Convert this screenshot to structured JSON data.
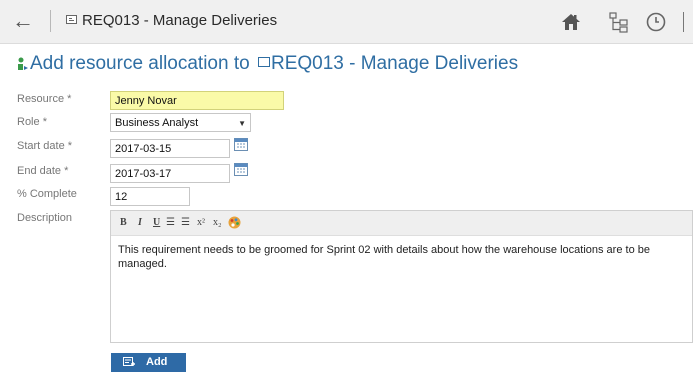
{
  "topbar": {
    "back_glyph": "←",
    "title": "REQ013 - Manage Deliveries",
    "icons": [
      "back-arrow-icon",
      "requirement-icon",
      "home-icon",
      "hierarchy-icon",
      "clock-icon"
    ]
  },
  "page": {
    "heading_prefix": "Add resource allocation to ",
    "heading_item": "REQ013 - Manage Deliveries",
    "heading_icon": "resource-allocation-icon",
    "accent_color": "#2f6ea3"
  },
  "form": {
    "resource": {
      "label": "Resource",
      "required_mark": "*",
      "value": "Jenny Novar",
      "highlight_color": "#fafaa8"
    },
    "role": {
      "label": "Role",
      "required_mark": "*",
      "value": "Business Analyst",
      "arrow": "▼"
    },
    "start_date": {
      "label": "Start date",
      "required_mark": "*",
      "value": "2017-03-15"
    },
    "end_date": {
      "label": "End date",
      "required_mark": "*",
      "value": "2017-03-17"
    },
    "percent_complete": {
      "label": "% Complete",
      "value": "12"
    },
    "description": {
      "label": "Description",
      "toolbar": {
        "bold": "B",
        "italic": "I",
        "underline": "U",
        "bulleted_list": "☰",
        "numbered_list": "☰",
        "superscript": "x²",
        "subscript": "x₂",
        "color": "color-palette-icon"
      },
      "text": "This requirement needs to be groomed for Sprint 02 with details about how the warehouse locations are to be managed."
    }
  },
  "actions": {
    "add_label": "Add",
    "add_icon": "add-resource-icon",
    "button_color": "#2e6aa6"
  }
}
